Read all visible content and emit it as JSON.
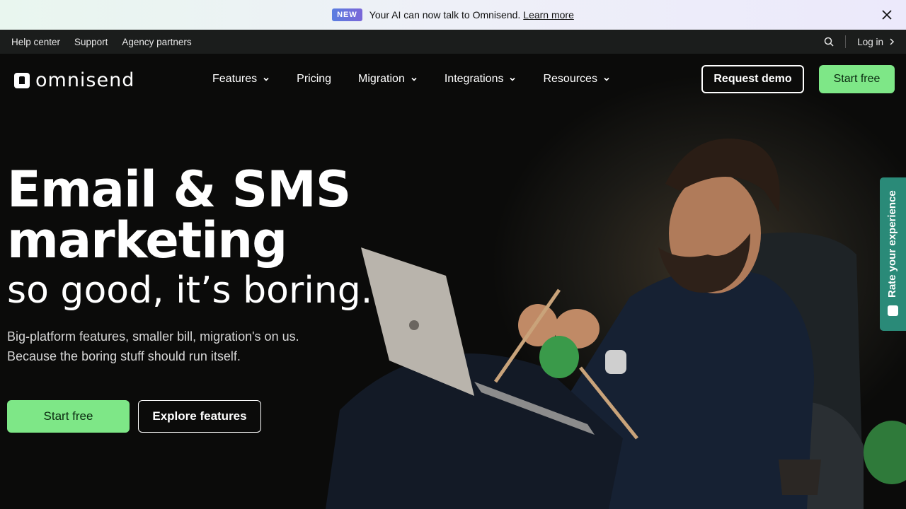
{
  "announcement": {
    "badge": "NEW",
    "text": "Your AI can now talk to Omnisend.",
    "link": "Learn more",
    "close_icon": "close-icon"
  },
  "utility": {
    "links": [
      "Help center",
      "Support",
      "Agency partners"
    ],
    "login": "Log in",
    "search_icon": "search-icon"
  },
  "nav": {
    "logo_text": "omnisend",
    "items": [
      {
        "label": "Features",
        "dropdown": true
      },
      {
        "label": "Pricing",
        "dropdown": false
      },
      {
        "label": "Migration",
        "dropdown": true
      },
      {
        "label": "Integrations",
        "dropdown": true
      },
      {
        "label": "Resources",
        "dropdown": true
      }
    ],
    "demo_button": "Request demo",
    "start_button": "Start free"
  },
  "hero": {
    "title_line1": "Email & SMS",
    "title_line2": "marketing",
    "subtitle": "so good, it’s boring.",
    "lead_line1": "Big-platform features, smaller bill, migration's on us.",
    "lead_line2": "Because the boring stuff should run itself.",
    "primary_cta": "Start free",
    "secondary_cta": "Explore features"
  },
  "feedback_tab": {
    "label": "Rate your experience"
  },
  "colors": {
    "accent_green": "#7ee787",
    "feedback_teal": "#2a8a78",
    "background": "#0b0b0a"
  }
}
